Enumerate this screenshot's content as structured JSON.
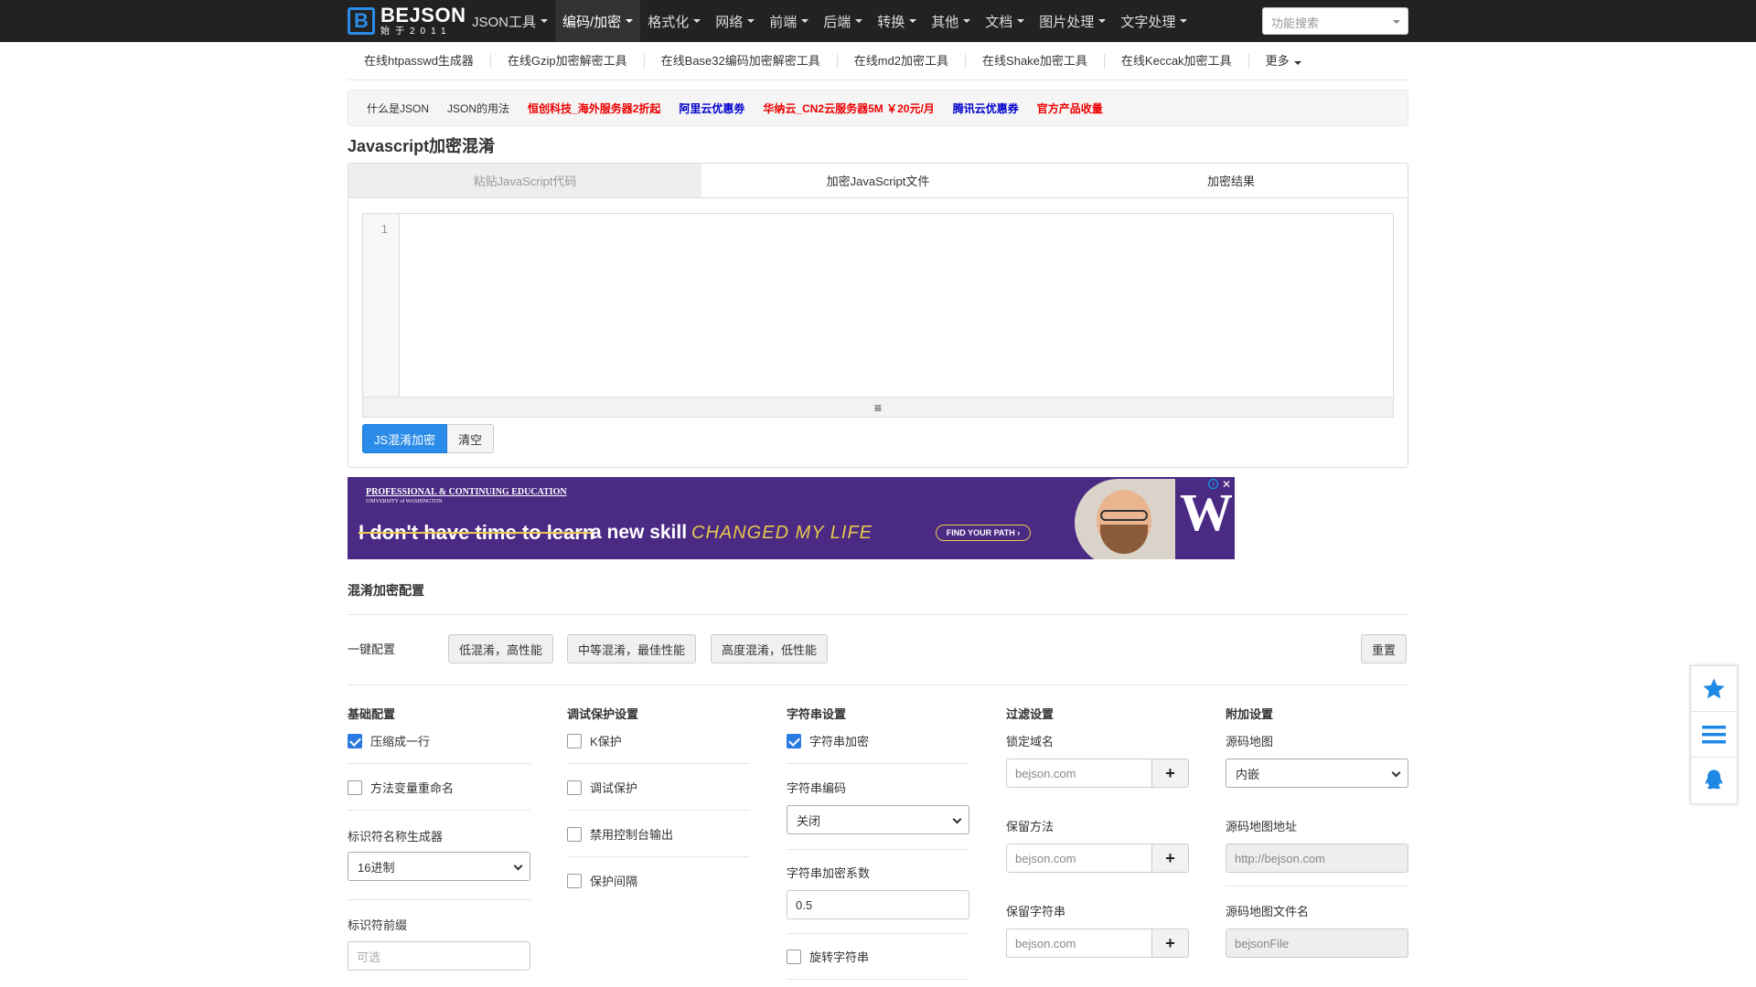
{
  "logo": {
    "mark": "B",
    "name": "BEJSON",
    "sub": "始于2011"
  },
  "nav": {
    "items": [
      {
        "label": "JSON工具"
      },
      {
        "label": "编码/加密"
      },
      {
        "label": "格式化"
      },
      {
        "label": "网络"
      },
      {
        "label": "前端"
      },
      {
        "label": "后端"
      },
      {
        "label": "转换"
      },
      {
        "label": "其他"
      },
      {
        "label": "文档"
      },
      {
        "label": "图片处理"
      },
      {
        "label": "文字处理"
      }
    ],
    "active_index": 1,
    "search_placeholder": "功能搜索"
  },
  "subnav": [
    "在线htpasswd生成器",
    "在线Gzip加密解密工具",
    "在线Base32编码加密解密工具",
    "在线md2加密工具",
    "在线Shake加密工具",
    "在线Keccak加密工具",
    "更多"
  ],
  "linkbar": [
    {
      "label": "什么是JSON",
      "color": "dark"
    },
    {
      "label": "JSON的用法",
      "color": "dark"
    },
    {
      "label": "恒创科技_海外服务器2折起",
      "color": "red"
    },
    {
      "label": "阿里云优惠劵",
      "color": "blue"
    },
    {
      "label": "华纳云_CN2云服务器5M ￥20元/月",
      "color": "red"
    },
    {
      "label": "腾讯云优惠券",
      "color": "blue"
    },
    {
      "label": "官方产品收量",
      "color": "red"
    }
  ],
  "page_title": "Javascript加密混淆",
  "tabs": [
    "粘贴JavaScript代码",
    "加密JavaScript文件",
    "加密结果"
  ],
  "editor": {
    "line_numbers": [
      "1"
    ],
    "resize_handle": "≡"
  },
  "buttons": {
    "encrypt": "JS混淆加密",
    "clear": "清空"
  },
  "ad": {
    "org": "PROFESSIONAL & CONTINUING EDUCATION",
    "univ": "UNIVERSITY of WASHINGTON",
    "struck": "I don't have time to learn",
    "rest": "a new skill",
    "highlight": "CHANGED MY LIFE",
    "cta": "FIND YOUR PATH ›",
    "w": "W",
    "close": "✕",
    "info": "i"
  },
  "config": {
    "title": "混淆加密配置",
    "quick_label": "一键配置",
    "presets": [
      "低混淆，高性能",
      "中等混淆，最佳性能",
      "高度混淆，低性能"
    ],
    "reset": "重置"
  },
  "columns": {
    "basic": {
      "title": "基础配置",
      "compact": "压缩成一行",
      "rename": "方法变量重命名",
      "generator_label": "标识符名称生成器",
      "generator_value": "16进制",
      "prefix_label": "标识符前缀",
      "prefix_placeholder": "可选"
    },
    "debug": {
      "title": "调试保护设置",
      "k_protect": "K保护",
      "debug_protect": "调试保护",
      "disable_console": "禁用控制台输出",
      "interval": "保护间隔"
    },
    "string": {
      "title": "字符串设置",
      "encrypt": "字符串加密",
      "encoding_label": "字符串编码",
      "encoding_value": "关闭",
      "threshold_label": "字符串加密系数",
      "threshold_value": "0.5",
      "rotate": "旋转字符串"
    },
    "filter": {
      "title": "过滤设置",
      "domain_label": "锁定域名",
      "domain_placeholder": "bejson.com",
      "methods_label": "保留方法",
      "methods_placeholder": "bejson.com",
      "strings_label": "保留字符串",
      "strings_placeholder": "bejson.com",
      "add": "+"
    },
    "extra": {
      "title": "附加设置",
      "sourcemap_label": "源码地图",
      "sourcemap_value": "内嵌",
      "sourcemap_url_label": "源码地图地址",
      "sourcemap_url_placeholder": "http://bejson.com",
      "sourcemap_file_label": "源码地图文件名",
      "sourcemap_file_placeholder": "bejsonFile"
    }
  },
  "checkbox_states": {
    "compact": true,
    "rename": false,
    "k_protect": false,
    "debug_protect": false,
    "disable_console": false,
    "interval": false,
    "string_encrypt": true,
    "rotate": false
  },
  "float_toolbar": [
    "star-icon",
    "menu-icon",
    "qq-icon"
  ],
  "colors": {
    "accent": "#2a8be8",
    "navbar": "#222222",
    "ad_bg": "#4b2a84",
    "ad_gold": "#e8c84c",
    "link_red": "#ee0000",
    "link_blue": "#0000cc"
  }
}
